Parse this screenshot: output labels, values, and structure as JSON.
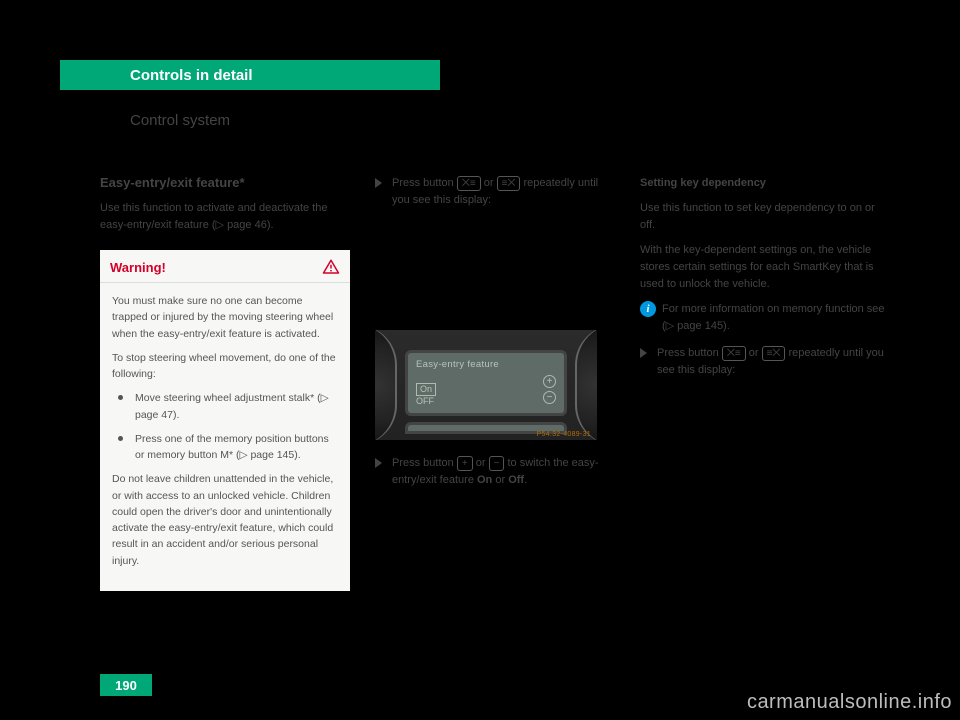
{
  "header": {
    "title": "Controls in detail"
  },
  "section_title": "Control system",
  "subsection_title": "Easy-entry/exit feature*",
  "intro": "Use this function to activate and deactivate the easy-entry/exit feature (▷ page 46).",
  "warning": {
    "title": "Warning!",
    "p1": "You must make sure no one can become trapped or injured by the moving steering wheel when the easy-entry/exit feature is activated.",
    "p2": "To stop steering wheel movement, do one of the following:",
    "bullets": [
      "Move steering wheel adjustment stalk* (▷ page 47).",
      "Press one of the memory position buttons or memory button M* (▷ page 145)."
    ],
    "p3": "Do not leave children unattended in the vehicle, or with access to an unlocked vehicle. Children could open the driver's door and unintentionally activate the easy-entry/exit feature, which could result in an accident and/or serious personal injury."
  },
  "col2": {
    "step1a": "Press button ",
    "step1_sym1": "⨉≡",
    "step1_mid": " or ",
    "step1_sym2": "≡⨉",
    "step1b": " repeatedly until you see this display:",
    "lcd_title": "Easy-entry feature",
    "lcd_on": "On",
    "lcd_off": "OFF",
    "img_code": "P54.32-4089-31",
    "step2a": "Press button ",
    "step2_plus": "+",
    "step2_or": " or ",
    "step2_minus": "−",
    "step2b": " to switch the easy-entry/exit feature ",
    "step2_on": "On",
    "step2_or2": " or ",
    "step2_off": "Off",
    "step2_end": "."
  },
  "col3": {
    "heading": "Setting key dependency",
    "p1": "Use this function to set key dependency to on or off.",
    "p2": "With the key-dependent settings on, the vehicle stores certain settings for each SmartKey that is used to unlock the vehicle.",
    "info": "For more information on memory function see (▷ page 145).",
    "step1a": "Press button ",
    "step1_sym1": "⨉≡",
    "step1_mid": " or ",
    "step1_sym2": "≡⨉",
    "step1b": " repeatedly until you see this display:"
  },
  "page_number": "190",
  "watermark": "carmanualsonline.info"
}
